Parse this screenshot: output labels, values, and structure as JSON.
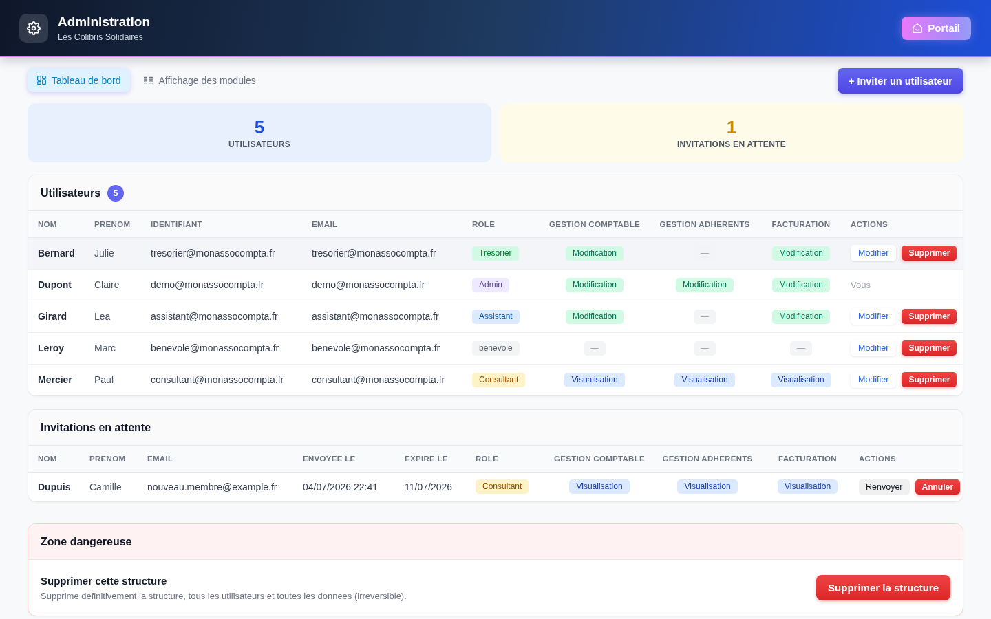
{
  "header": {
    "title": "Administration",
    "subtitle": "Les Colibris Solidaires",
    "portal_button": "Portail"
  },
  "tabs": [
    {
      "label": "Tableau de bord",
      "selected": true,
      "kind": "dashboard"
    },
    {
      "label": "Affichage des modules",
      "selected": false,
      "kind": "modules"
    }
  ],
  "invite_button": "+ Inviter un utilisateur",
  "stats": [
    {
      "value": "5",
      "label": "UTILISATEURS",
      "kind": "users"
    },
    {
      "value": "1",
      "label": "INVITATIONS EN ATTENTE",
      "kind": "invitations"
    }
  ],
  "users": {
    "title": "Utilisateurs",
    "count": "5",
    "columns": [
      "NOM",
      "PRENOM",
      "IDENTIFIANT",
      "EMAIL",
      "ROLE",
      "GESTION COMPTABLE",
      "GESTION ADHERENTS",
      "FACTURATION",
      "ACTIONS"
    ],
    "rows": [
      {
        "last_name": "Bernard",
        "first_name": "Julie",
        "username": "tresorier@monassocompta.fr",
        "email": "tresorier@monassocompta.fr",
        "role": {
          "label": "Tresorier",
          "color": "#d1fae5"
        },
        "permissions": [
          {
            "kind": "edit",
            "label": "Modification"
          },
          {
            "kind": "none",
            "label": "—"
          },
          {
            "kind": "edit",
            "label": "Modification"
          }
        ],
        "actions": [
          {
            "kind": "edit",
            "label": "Modifier"
          },
          {
            "kind": "delete",
            "label": "Supprimer"
          }
        ],
        "hovered": true
      },
      {
        "last_name": "Dupont",
        "first_name": "Claire",
        "username": "demo@monassocompta.fr",
        "email": "demo@monassocompta.fr",
        "role": {
          "label": "Admin",
          "color": "#ede9fe"
        },
        "permissions": [
          {
            "kind": "edit",
            "label": "Modification"
          },
          {
            "kind": "edit",
            "label": "Modification"
          },
          {
            "kind": "edit",
            "label": "Modification"
          }
        ],
        "actions": [
          {
            "kind": "note",
            "label": "Vous"
          }
        ],
        "hovered": false
      },
      {
        "last_name": "Girard",
        "first_name": "Lea",
        "username": "assistant@monassocompta.fr",
        "email": "assistant@monassocompta.fr",
        "role": {
          "label": "Assistant",
          "color": "#dbeafe"
        },
        "permissions": [
          {
            "kind": "edit",
            "label": "Modification"
          },
          {
            "kind": "none",
            "label": "—"
          },
          {
            "kind": "edit",
            "label": "Modification"
          }
        ],
        "actions": [
          {
            "kind": "edit",
            "label": "Modifier"
          },
          {
            "kind": "delete",
            "label": "Supprimer"
          }
        ],
        "hovered": false
      },
      {
        "last_name": "Leroy",
        "first_name": "Marc",
        "username": "benevole@monassocompta.fr",
        "email": "benevole@monassocompta.fr",
        "role": {
          "label": "benevole",
          "color": "#f3f4f6"
        },
        "permissions": [
          {
            "kind": "none",
            "label": "—"
          },
          {
            "kind": "none",
            "label": "—"
          },
          {
            "kind": "none",
            "label": "—"
          }
        ],
        "actions": [
          {
            "kind": "edit",
            "label": "Modifier"
          },
          {
            "kind": "delete",
            "label": "Supprimer"
          }
        ],
        "hovered": false
      },
      {
        "last_name": "Mercier",
        "first_name": "Paul",
        "username": "consultant@monassocompta.fr",
        "email": "consultant@monassocompta.fr",
        "role": {
          "label": "Consultant",
          "color": "#fef3c7"
        },
        "permissions": [
          {
            "kind": "view",
            "label": "Visualisation"
          },
          {
            "kind": "view",
            "label": "Visualisation"
          },
          {
            "kind": "view",
            "label": "Visualisation"
          }
        ],
        "actions": [
          {
            "kind": "edit",
            "label": "Modifier"
          },
          {
            "kind": "delete",
            "label": "Supprimer"
          }
        ],
        "hovered": false
      }
    ]
  },
  "invitations": {
    "title": "Invitations en attente",
    "columns": [
      "NOM",
      "PRENOM",
      "EMAIL",
      "ENVOYEE LE",
      "EXPIRE LE",
      "ROLE",
      "GESTION COMPTABLE",
      "GESTION ADHERENTS",
      "FACTURATION",
      "ACTIONS"
    ],
    "rows": [
      {
        "last_name": "Dupuis",
        "first_name": "Camille",
        "email": "nouveau.membre@example.fr",
        "sent": "04/07/2026 22:41",
        "expires": "11/07/2026",
        "role": {
          "label": "Consultant",
          "color": "#fef3c7"
        },
        "permissions": [
          {
            "kind": "view",
            "label": "Visualisation"
          },
          {
            "kind": "view",
            "label": "Visualisation"
          },
          {
            "kind": "view",
            "label": "Visualisation"
          }
        ],
        "actions": [
          {
            "kind": "resend",
            "label": "Renvoyer"
          },
          {
            "kind": "cancel",
            "label": "Annuler"
          }
        ]
      }
    ]
  },
  "danger_zone": {
    "title": "Zone dangereuse",
    "item_title": "Supprimer cette structure",
    "description": "Supprime definitivement la structure, tous les utilisateurs et toutes les donnees (irreversible).",
    "button": "Supprimer la structure"
  }
}
